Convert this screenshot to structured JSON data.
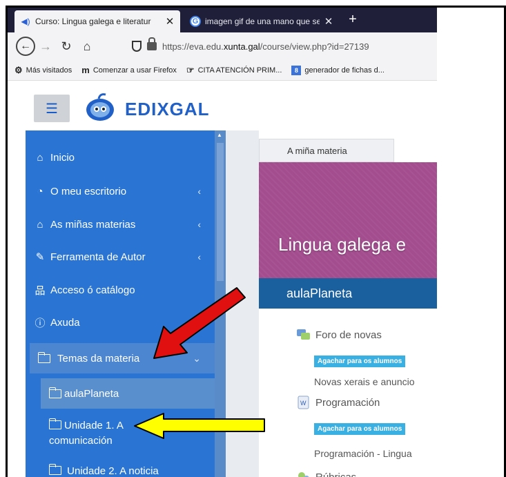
{
  "browser": {
    "tabs": [
      {
        "label": "Curso: Lingua galega e literatur",
        "active": true,
        "icon": "audio-icon"
      },
      {
        "label": "imagen gif de una mano que se",
        "active": false,
        "icon": "google-icon"
      }
    ],
    "new_tab": "+",
    "close_glyph": "✕",
    "url_prefix": "https://eva.edu.",
    "url_host": "xunta.gal",
    "url_path": "/course/view.php?id=27139",
    "bookmarks": [
      {
        "label": "Más visitados",
        "icon": "gear-icon"
      },
      {
        "label": "Comenzar a usar Firefox",
        "icon": "m-icon"
      },
      {
        "label": "CITA ATENCIÓN PRIM...",
        "icon": "hand-icon"
      },
      {
        "label": "generador de fichas d...",
        "icon": "square-8-icon"
      }
    ]
  },
  "site": {
    "logo_text": "EDIXGAL"
  },
  "sidebar": {
    "items": [
      {
        "label": "Inicio",
        "icon": "home-icon",
        "chevron": false
      },
      {
        "label": "O meu escritorio",
        "icon": "gauge-icon",
        "chevron": true
      },
      {
        "label": "As miñas materias",
        "icon": "graduation-cap-icon",
        "chevron": true
      },
      {
        "label": "Ferramenta de Autor",
        "icon": "pencil-icon",
        "chevron": true
      },
      {
        "label": "Acceso ó catálogo",
        "icon": "sitemap-icon",
        "chevron": false
      },
      {
        "label": "Axuda",
        "icon": "question-circle-icon",
        "chevron": false
      },
      {
        "label": "Temas da materia",
        "icon": "folder-icon",
        "chevron": true
      }
    ],
    "chevron_glyph": "‹",
    "chevron_open_glyph": "⌄",
    "subitems": [
      {
        "label": "aulaPlaneta"
      },
      {
        "label_line1": "Unidade 1. A",
        "label_line2": "comunicación"
      },
      {
        "label": "Unidade 2. A noticia"
      }
    ]
  },
  "content": {
    "tab_label": "A miña materia",
    "banner_title": "Lingua galega e",
    "banner_bar": "aulaPlaneta",
    "activities": [
      {
        "label": "Foro de novas",
        "icon": "forum-icon"
      },
      {
        "label": "Programación",
        "icon": "word-doc-icon"
      },
      {
        "label": "Rúbricas",
        "icon": "rubric-icon"
      }
    ],
    "badge_text": "Agachar para os alumnos",
    "descriptions": [
      "Novas xerais e anuncio",
      "Programación - Lingua"
    ]
  },
  "colors": {
    "sidebar": "#2a75d4",
    "banner": "#a34d8f",
    "banner_bar": "#1a5f9e",
    "red_arrow": "#e01010",
    "yellow_arrow": "#ffff00"
  }
}
